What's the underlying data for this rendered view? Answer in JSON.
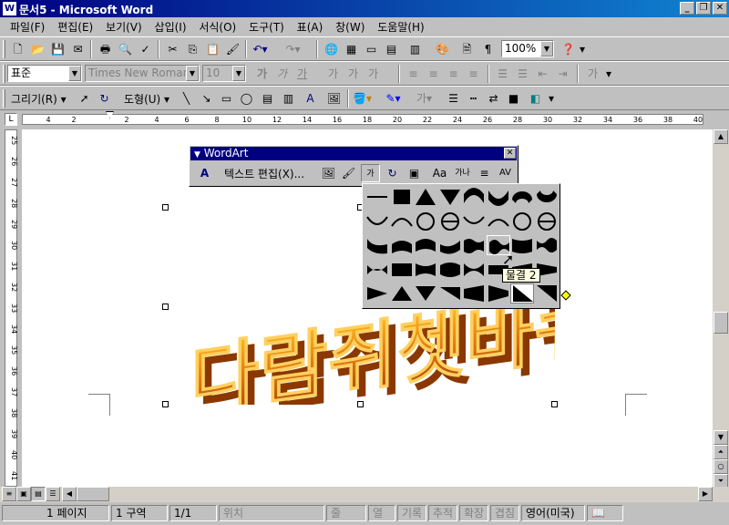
{
  "window": {
    "title": "문서5 - Microsoft Word",
    "icon": "word-doc-icon",
    "controls": [
      "minimize-icon",
      "restore-icon",
      "close-icon"
    ]
  },
  "menu": {
    "items": [
      "파일(F)",
      "편집(E)",
      "보기(V)",
      "삽입(I)",
      "서식(O)",
      "도구(T)",
      "표(A)",
      "창(W)",
      "도움말(H)"
    ]
  },
  "standard_toolbar": {
    "zoom": "100%"
  },
  "formatting_toolbar": {
    "style": "표준",
    "font": "Times New Roman",
    "size": "10"
  },
  "drawing_toolbar": {
    "draw_label": "그리기(R)",
    "autoshape_label": "도형(U)"
  },
  "ruler": {
    "labels": [
      "4",
      "2",
      "2",
      "4",
      "6",
      "8",
      "10",
      "12",
      "14",
      "16",
      "18",
      "20",
      "22",
      "24",
      "26",
      "28",
      "30",
      "32",
      "34",
      "36",
      "38",
      "40"
    ],
    "vlabels": [
      "25",
      "26",
      "27",
      "28",
      "29",
      "30",
      "31",
      "32",
      "33",
      "34",
      "35",
      "36",
      "37",
      "38",
      "39",
      "40",
      "41"
    ]
  },
  "wordart": {
    "panel_title": "WordArt",
    "edit_text_label": "텍스트 편집(X)...",
    "text": "다람쥐쳇바퀴",
    "tooltip": "물결 2"
  },
  "status": {
    "page": "1 페이지",
    "section": "1 구역",
    "pages": "1/1",
    "position": "위치",
    "line": "줄",
    "column": "열",
    "rec": "기록",
    "trk": "추적",
    "ext": "확장",
    "ovr": "겹침",
    "language": "영어(미국)"
  },
  "colors": {
    "titlebar": "#000080",
    "wordart": "#e07810",
    "selected_shape": "#ffffff"
  }
}
